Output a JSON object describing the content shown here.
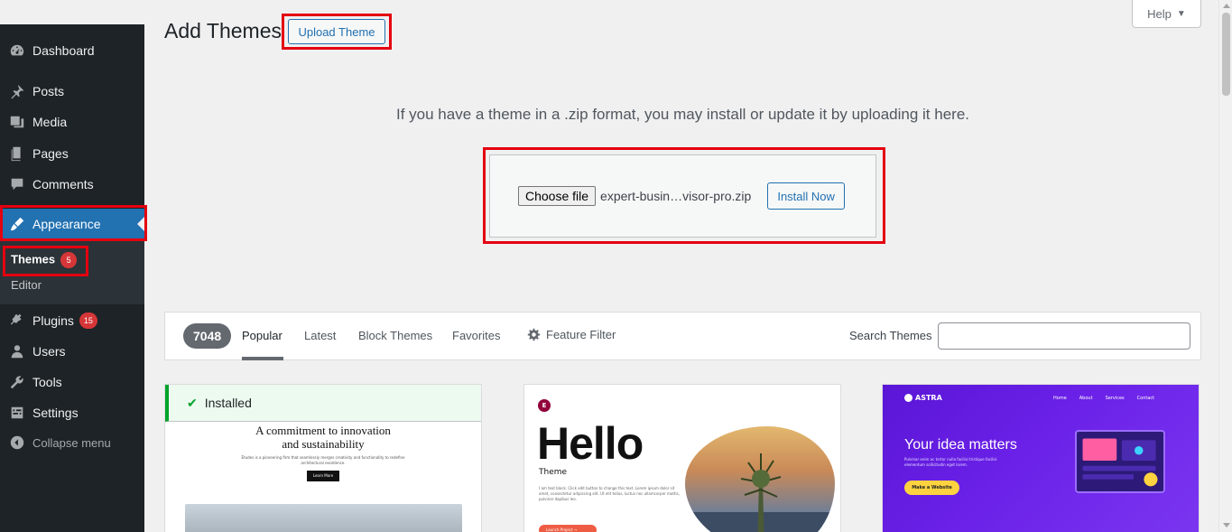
{
  "sidebar": {
    "items": [
      {
        "label": "Dashboard",
        "icon": "dashboard-icon"
      },
      {
        "label": "Posts",
        "icon": "pin-icon"
      },
      {
        "label": "Media",
        "icon": "media-icon"
      },
      {
        "label": "Pages",
        "icon": "pages-icon"
      },
      {
        "label": "Comments",
        "icon": "comment-icon"
      },
      {
        "label": "Appearance",
        "icon": "brush-icon"
      },
      {
        "label": "Plugins",
        "icon": "plugin-icon",
        "badge": "15"
      },
      {
        "label": "Users",
        "icon": "user-icon"
      },
      {
        "label": "Tools",
        "icon": "wrench-icon"
      },
      {
        "label": "Settings",
        "icon": "settings-icon"
      }
    ],
    "submenu": [
      {
        "label": "Themes",
        "badge": "5"
      },
      {
        "label": "Editor"
      }
    ],
    "collapse_label": "Collapse menu"
  },
  "header": {
    "title": "Add Themes",
    "upload_button": "Upload Theme",
    "help_label": "Help"
  },
  "upload": {
    "description": "If you have a theme in a .zip format, you may install or update it by uploading it here.",
    "choose_file_label": "Choose file",
    "file_name": "expert-busin…visor-pro.zip",
    "install_button": "Install Now"
  },
  "filter": {
    "count": "7048",
    "tabs": [
      "Popular",
      "Latest",
      "Block Themes",
      "Favorites"
    ],
    "feature_filter": "Feature Filter",
    "search_label": "Search Themes",
    "search_value": ""
  },
  "themes": [
    {
      "installed_label": "Installed",
      "preview_heading_line1": "A commitment to innovation",
      "preview_heading_line2": "and sustainability",
      "preview_text": "Études is a pioneering firm that seamlessly merges creativity and functionality to redefine architectural excellence.",
      "preview_button": "Learn More"
    },
    {
      "logo": "E",
      "title": "Hello",
      "subtitle": "Theme",
      "text": "I am text block. Click edit button to change this text. Lorem ipsum dolor sit amet, consectetur adipiscing elit. Ut elit tellus, luctus nec ullamcorper mattis, pulvinar dapibus leo.",
      "button": "Launch Project →"
    },
    {
      "logo": "ASTRA",
      "nav": [
        "Home",
        "About",
        "Services",
        "Contact"
      ],
      "title": "Your idea matters",
      "text": "Pulvinar enim ac tortor nulla facilisi tristique facilisi elementum sollicitudin eget lorem.",
      "button": "Make a Website"
    }
  ],
  "colors": {
    "sidebar_bg": "#1d2327",
    "accent": "#2271b1",
    "badge": "#d63638",
    "highlight_box": "#e4000f",
    "installed": "#00a32a"
  }
}
